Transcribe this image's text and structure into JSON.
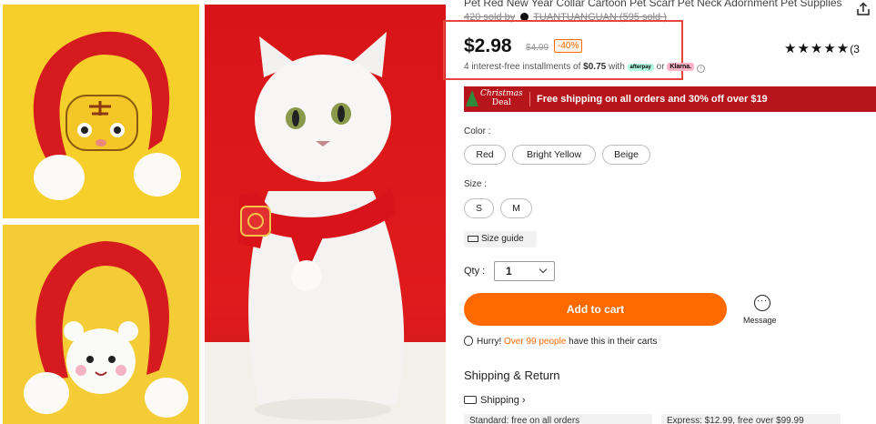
{
  "product": {
    "title": "Pet Red New Year Collar Cartoon Pet Scarf Pet Neck Adornment Pet Supplies",
    "sold_text": "420 sold by",
    "seller": "TUANTUANGUAN (595 sold )"
  },
  "pricing": {
    "price": "$2.98",
    "original_price": "$4.99",
    "discount": "-40%",
    "installment_prefix": "4 interest-free installments of ",
    "installment_amount": "$0.75",
    "installment_with": " with ",
    "afterpay_label": "afterpay",
    "or_text": " or ",
    "klarna_label": "Klarna.",
    "info_glyph": "i"
  },
  "rating": {
    "stars": "★★★★★",
    "count": "(3"
  },
  "promo": {
    "badge_title": "Christmas",
    "badge_sub": "Deal",
    "text": "Free shipping on all orders and 30% off over $19"
  },
  "options": {
    "color_label": "Color :",
    "colors": [
      "Red",
      "Bright Yellow",
      "Beige"
    ],
    "size_label": "Size :",
    "sizes": [
      "S",
      "M"
    ],
    "size_guide": "Size guide"
  },
  "quantity": {
    "label": "Qty :",
    "value": "1"
  },
  "actions": {
    "add_to_cart": "Add to cart",
    "message": "Message",
    "message_glyph": "···"
  },
  "hurry": {
    "prefix": "Hurry! ",
    "highlight": "Over 99 people",
    "suffix": " have this in their carts"
  },
  "shipping": {
    "heading": "Shipping & Return",
    "link": "Shipping ›",
    "row1": "Standard: free on all orders",
    "row2": "Express: $12.99, free over $99.99"
  },
  "colors": {
    "accent": "#ff6a00",
    "promo_bar": "#b5151b",
    "highlight_border": "#e8453b"
  }
}
